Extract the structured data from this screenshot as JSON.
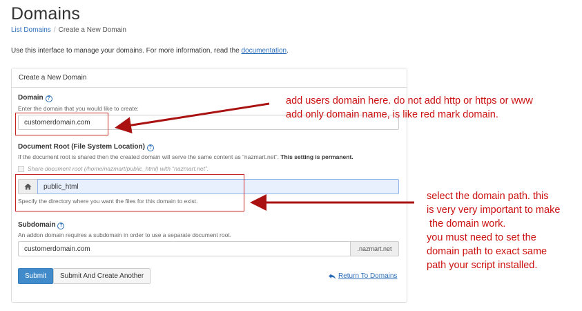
{
  "header": {
    "title": "Domains",
    "breadcrumb": {
      "link": "List Domains",
      "separator": "/",
      "current": "Create a New Domain"
    },
    "intro_text": "Use this interface to manage your domains. For more information, read the ",
    "intro_link": "documentation",
    "intro_end": "."
  },
  "panel": {
    "heading": "Create a New Domain",
    "domain": {
      "label": "Domain",
      "hint": "Enter the domain that you would like to create:",
      "value": "customerdomain.com"
    },
    "docroot": {
      "label": "Document Root (File System Location)",
      "hint_prefix": "If the document root is shared then the created domain will serve the same content as “nazmart.net”. ",
      "hint_bold": "This setting is permanent.",
      "share_label": "Share document root (/home/nazmart/public_html) with “nazmart.net”.",
      "value": "public_html",
      "help": "Specify the directory where you want the files for this domain to exist."
    },
    "subdomain": {
      "label": "Subdomain",
      "hint": "An addon domain requires a subdomain in order to use a separate document root.",
      "value": "customerdomain.com",
      "suffix": ".nazmart.net"
    },
    "buttons": {
      "submit": "Submit",
      "submit_another": "Submit And Create Another",
      "return": "Return To Domains"
    }
  },
  "annotations": {
    "domain_note": [
      "add users domain here. do not add http or https or www",
      "add only domain name, is like red mark domain."
    ],
    "path_note": [
      "select the domain path. this",
      "is very very important to make",
      " the domain work.",
      "you must need to set the",
      "domain path to exact same",
      "path your script installed."
    ]
  },
  "colors": {
    "accent": "#428bca",
    "link": "#2a6ebb",
    "annotation": "#cc1111"
  }
}
